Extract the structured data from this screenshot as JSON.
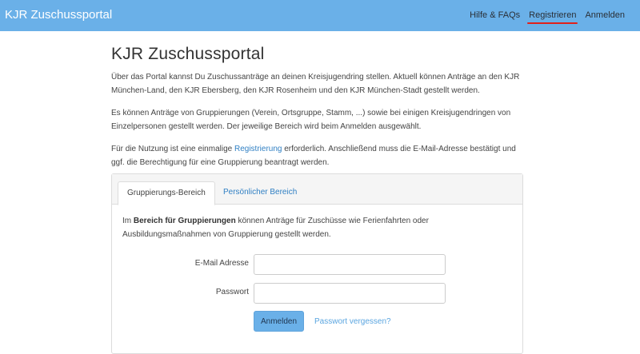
{
  "navbar": {
    "brand": "KJR Zuschussportal",
    "links": [
      {
        "label": "Hilfe & FAQs"
      },
      {
        "label": "Registrieren"
      },
      {
        "label": "Anmelden"
      }
    ]
  },
  "main": {
    "title": "KJR Zuschussportal",
    "paragraph1": "Über das Portal kannst Du Zuschussanträge an deinen Kreisjugendring stellen. Aktuell können Anträge an den KJR München-Land, den KJR Ebersberg, den KJR Rosenheim und den KJR München-Stadt gestellt werden.",
    "paragraph2": "Es können Anträge von Gruppierungen (Verein, Ortsgruppe, Stamm, ...) sowie bei einigen Kreisjugendringen von Einzelpersonen gestellt werden. Der jeweilige Bereich wird beim Anmelden ausgewählt.",
    "paragraph3_before": "Für die Nutzung ist eine einmalige ",
    "paragraph3_link": "Registrierung",
    "paragraph3_after": " erforderlich. Anschließend muss die E-Mail-Adresse bestätigt und ggf. die Berechtigung für eine Gruppierung beantragt werden."
  },
  "panel": {
    "tabs": [
      {
        "label": "Gruppierungs-Bereich"
      },
      {
        "label": "Persönlicher Bereich"
      }
    ],
    "text_before": "Im ",
    "text_strong": "Bereich für Gruppierungen",
    "text_after": " können Anträge für Zuschüsse wie Ferienfahrten oder Ausbildungsmaßnahmen von Gruppierung gestellt werden.",
    "email_label": "E-Mail Adresse",
    "email_value": "",
    "password_label": "Passwort",
    "password_value": "",
    "submit_label": "Anmelden",
    "forgot_label": "Passwort vergessen?"
  },
  "colors": {
    "navbar": "#6ab0e8",
    "link": "#2f7fc3",
    "active_underline": "#e2201a"
  }
}
